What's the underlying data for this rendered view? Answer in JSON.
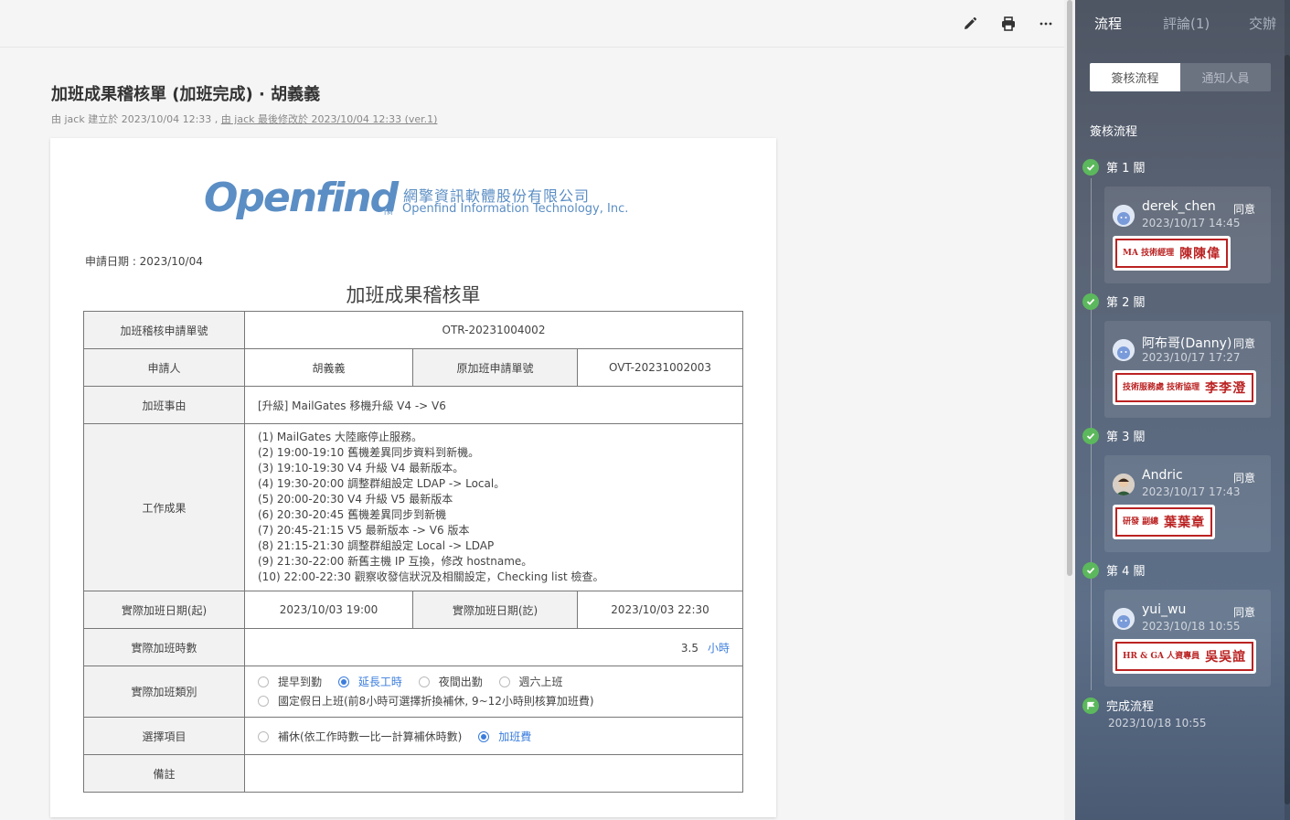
{
  "doc": {
    "title": "加班成果稽核單 (加班完成) · 胡義義",
    "meta_created": "由 jack 建立於 2023/10/04 12:33 , ",
    "meta_modified": "由 jack 最後修改於 2023/10/04 12:33 (ver.1)"
  },
  "toolbar": {
    "edit_icon": "pencil-icon",
    "print_icon": "printer-icon",
    "more_icon": "more-icon"
  },
  "paper": {
    "logo_word": "Openfind",
    "logo_tm": "TM",
    "company_cn": "網擎資訊軟體股份有限公司",
    "company_en": "Openfind Information Technology, Inc.",
    "apply_date": "申請日期 : 2023/10/04",
    "form_title": "加班成果稽核單"
  },
  "form": {
    "no_label": "加班稽核申請單號",
    "no_value": "OTR-20231004002",
    "applicant_label": "申請人",
    "applicant_value": "胡義義",
    "orig_no_label": "原加班申請單號",
    "orig_no_value": "OVT-20231002003",
    "reason_label": "加班事由",
    "reason_value": "[升級] MailGates 移機升級 V4 -> V6",
    "result_label": "工作成果",
    "results": [
      "(1) MailGates 大陸廠停止服務。",
      "(2) 19:00-19:10 舊機差異同步資料到新機。",
      "(3) 19:10-19:30 V4 升級 V4 最新版本。",
      "(4) 19:30-20:00 調整群組設定 LDAP -> Local。",
      "(5) 20:00-20:30 V4 升級 V5 最新版本",
      "(6) 20:30-20:45 舊機差異同步到新機",
      "(7) 20:45-21:15 V5 最新版本 -> V6 版本",
      "(8) 21:15-21:30 調整群組設定 Local -> LDAP",
      "(9) 21:30-22:00 新舊主機 IP 互換，修改 hostname。",
      "(10) 22:00-22:30 觀察收發信狀況及相關設定，Checking list 檢查。"
    ],
    "start_label": "實際加班日期(起)",
    "start_value": "2023/10/03 19:00",
    "end_label": "實際加班日期(訖)",
    "end_value": "2023/10/03 22:30",
    "hours_label": "實際加班時數",
    "hours_value": "3.5",
    "hours_unit": "小時",
    "type_label": "實際加班類別",
    "type_options": [
      "提早到勤",
      "延長工時",
      "夜間出勤",
      "週六上班",
      "國定假日上班(前8小時可選擇折換補休, 9~12小時則核算加班費)"
    ],
    "type_selected": "延長工時",
    "choice_label": "選擇項目",
    "choice_options": [
      "補休(依工作時數一比一計算補休時數)",
      "加班費"
    ],
    "choice_selected": "加班費",
    "note_label": "備註",
    "note_value": ""
  },
  "side": {
    "tabs": [
      "流程",
      "評論(1)",
      "交辦"
    ],
    "active_tab": "流程",
    "seg": [
      "簽核流程",
      "通知人員"
    ],
    "section_title": "簽核流程",
    "stages": [
      {
        "head": "第 1 關",
        "name": "derek_chen",
        "status": "同意",
        "time": "2023/10/17 14:45",
        "seal_title": "MA 技術經理",
        "seal_name": "陳陳偉"
      },
      {
        "head": "第 2 關",
        "name": "阿布哥(Danny)",
        "status": "同意",
        "time": "2023/10/17 17:27",
        "seal_title": "技術服務處 技術協理",
        "seal_name": "李李澄"
      },
      {
        "head": "第 3 關",
        "name": "Andric",
        "status": "同意",
        "time": "2023/10/17 17:43",
        "seal_title": "研發 副總",
        "seal_name": "葉葉章"
      },
      {
        "head": "第 4 關",
        "name": "yui_wu",
        "status": "同意",
        "time": "2023/10/18 10:55",
        "seal_title": "HR & GA 人資專員",
        "seal_name": "吳吳誼"
      }
    ],
    "finish_label": "完成流程",
    "finish_time": "2023/10/18 10:55"
  }
}
